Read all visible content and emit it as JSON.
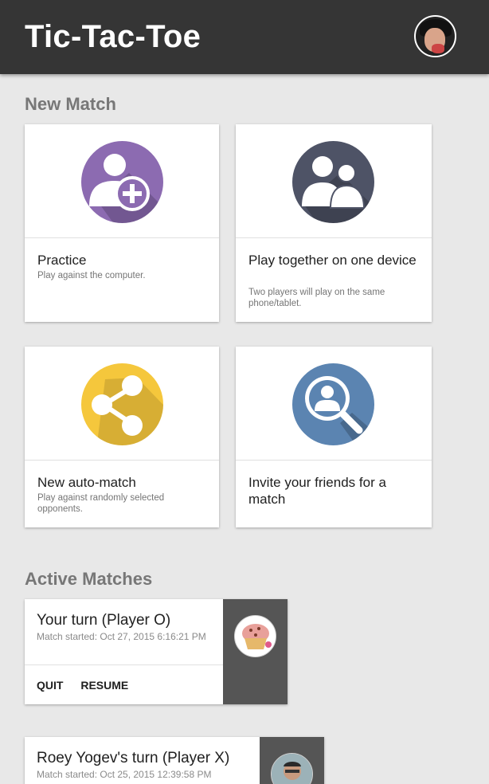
{
  "app": {
    "title": "Tic-Tac-Toe"
  },
  "sections": {
    "new_match": "New Match",
    "active_matches": "Active Matches"
  },
  "new_match_cards": [
    {
      "label": "Practice",
      "sub": "Play against the computer.",
      "icon": "add-user-icon",
      "color": "#8c6bb1"
    },
    {
      "label": "Play together on one device",
      "sub": "Two players will play on the same phone/tablet.",
      "icon": "two-users-icon",
      "color": "#4e5366"
    },
    {
      "label": "New auto-match",
      "sub": "Play against randomly selected opponents.",
      "icon": "share-icon",
      "color": "#f5c73c"
    },
    {
      "label": "Invite your friends for a match",
      "sub": "",
      "icon": "search-user-icon",
      "color": "#5b84b1"
    }
  ],
  "active_matches": [
    {
      "title": "Your turn (Player O)",
      "started": "Match started: Oct 27, 2015 6:16:21 PM",
      "actions": [
        "QUIT",
        "RESUME"
      ],
      "avatar": "muffin-avatar"
    },
    {
      "title": "Roey Yogev's turn (Player X)",
      "started": "Match started: Oct 25, 2015 12:39:58 PM",
      "actions": [],
      "avatar": "person-avatar"
    }
  ]
}
